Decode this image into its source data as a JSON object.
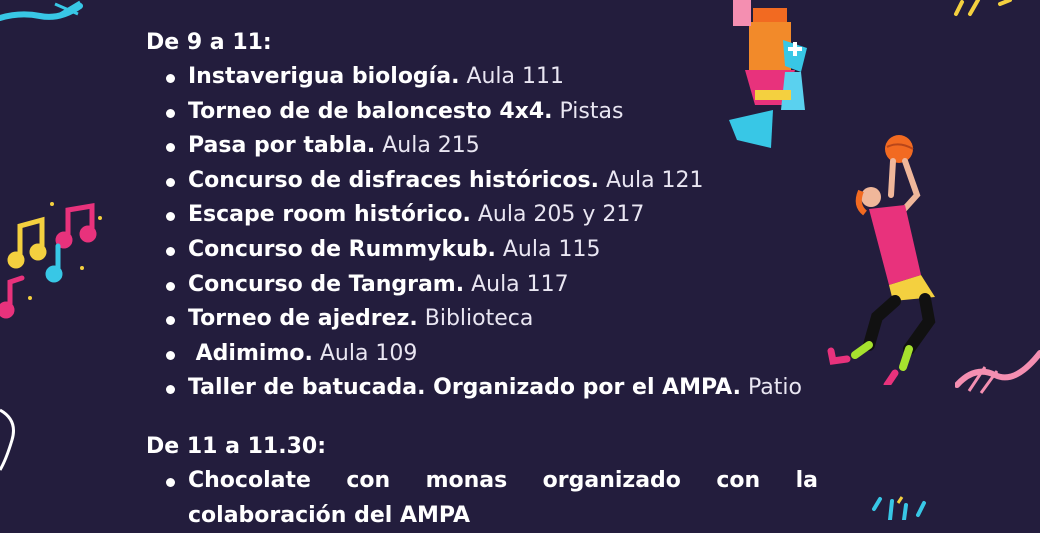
{
  "section1": {
    "heading": "De 9 a 11:",
    "items": [
      {
        "title": "Instaverigua biología.",
        "place": "Aula 111"
      },
      {
        "title": "Torneo de de baloncesto 4x4.",
        "place": "Pistas"
      },
      {
        "title": "Pasa por tabla.",
        "place": "Aula 215"
      },
      {
        "title": "Concurso de disfraces históricos.",
        "place": "Aula 121"
      },
      {
        "title": "Escape room histórico.",
        "place": "Aula 205 y 217"
      },
      {
        "title": "Concurso de Rummykub.",
        "place": "Aula 115"
      },
      {
        "title": "Concurso de Tangram.",
        "place": "Aula 117"
      },
      {
        "title": "Torneo de ajedrez.",
        "place": "Biblioteca"
      },
      {
        "title": " Adimimo.",
        "place": "Aula 109"
      },
      {
        "title": "Taller de batucada. Organizado por el AMPA.",
        "place": "Patio"
      }
    ]
  },
  "section2": {
    "heading": "De 11 a 11.30:",
    "item_words": [
      "Chocolate",
      "con",
      "monas",
      "organizado",
      "con",
      "la"
    ],
    "item_cut_line": "colaboración del AMPA"
  },
  "decorations": {
    "chess_icon": "chess-pieces",
    "music_icon": "music-notes",
    "player_icon": "basketball-player",
    "colors": {
      "background": "#231d3d",
      "orange": "#f26a21",
      "cyan": "#38c7e6",
      "pink": "#e8327c",
      "yellow": "#f4d03f"
    }
  }
}
